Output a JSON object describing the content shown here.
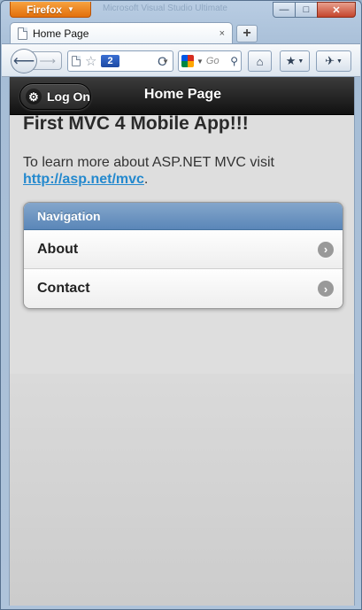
{
  "browser": {
    "menu_button_label": "Firefox",
    "menu_caret": "▼",
    "window_title": "Microsoft Visual Studio Ultimate",
    "window_controls": {
      "minimize": "—",
      "maximize": "□",
      "close": "✕"
    },
    "tab": {
      "title": "Home Page",
      "close": "×"
    },
    "new_tab_label": "+",
    "nav": {
      "back": "⟵",
      "forward": "⟶",
      "reload": "C"
    },
    "urlbar": {
      "badge": "2",
      "dropdown": "▼"
    },
    "search": {
      "placeholder": "Go",
      "dropdown": "▼",
      "magnifier": "⚲"
    },
    "buttons": {
      "home": "⌂",
      "bookmarks": "★",
      "addon": "✈",
      "dropdown": "▼"
    }
  },
  "app": {
    "header": {
      "logon_label": "Log On",
      "title": "Home Page"
    },
    "content": {
      "title": "First MVC 4 Mobile App!!!",
      "intro_text": "To learn more about ASP.NET MVC visit",
      "intro_link": "http://asp.net/mvc",
      "intro_trailing": "."
    },
    "navigation": {
      "header": "Navigation",
      "items": [
        {
          "label": "About"
        },
        {
          "label": "Contact"
        }
      ]
    }
  },
  "colors": {
    "firefox_orange": "#e2700c",
    "header_black": "#111111",
    "divider_blue": "#5a86b8",
    "link_blue": "#2489ce"
  }
}
